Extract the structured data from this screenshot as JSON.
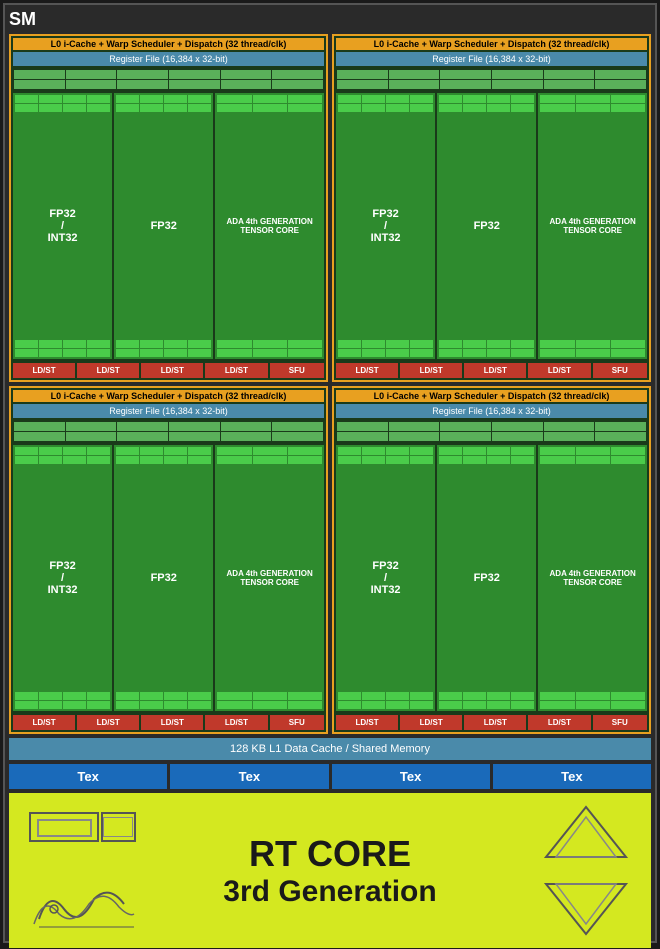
{
  "sm": {
    "title": "SM",
    "quadrants": [
      {
        "l0_cache": "L0 i-Cache + Warp Scheduler + Dispatch (32 thread/clk)",
        "register_file": "Register File (16,384 x 32-bit)",
        "fp32_int32_label": "FP32 / INT32",
        "fp32_label": "FP32",
        "tensor_label": "ADA 4th GENERATION TENSOR CORE",
        "ldst_labels": [
          "LD/ST",
          "LD/ST",
          "LD/ST",
          "LD/ST"
        ],
        "sfu_label": "SFU"
      },
      {
        "l0_cache": "L0 i-Cache + Warp Scheduler + Dispatch (32 thread/clk)",
        "register_file": "Register File (16,384 x 32-bit)",
        "fp32_int32_label": "FP32 / INT32",
        "fp32_label": "FP32",
        "tensor_label": "ADA 4th GENERATION TENSOR CORE",
        "ldst_labels": [
          "LD/ST",
          "LD/ST",
          "LD/ST",
          "LD/ST"
        ],
        "sfu_label": "SFU"
      },
      {
        "l0_cache": "L0 i-Cache + Warp Scheduler + Dispatch (32 thread/clk)",
        "register_file": "Register File (16,384 x 32-bit)",
        "fp32_int32_label": "FP32 / INT32",
        "fp32_label": "FP32",
        "tensor_label": "ADA 4th GENERATION TENSOR CORE",
        "ldst_labels": [
          "LD/ST",
          "LD/ST",
          "LD/ST",
          "LD/ST"
        ],
        "sfu_label": "SFU"
      },
      {
        "l0_cache": "L0 i-Cache + Warp Scheduler + Dispatch (32 thread/clk)",
        "register_file": "Register File (16,384 x 32-bit)",
        "fp32_int32_label": "FP32 / INT32",
        "fp32_label": "FP32",
        "tensor_label": "ADA 4th GENERATION TENSOR CORE",
        "ldst_labels": [
          "LD/ST",
          "LD/ST",
          "LD/ST",
          "LD/ST"
        ],
        "sfu_label": "SFU"
      }
    ],
    "l1_cache": "128 KB L1 Data Cache / Shared Memory",
    "tex_labels": [
      "Tex",
      "Tex",
      "Tex",
      "Tex"
    ],
    "rt_core": {
      "title": "RT CORE",
      "subtitle": "3rd Generation"
    }
  }
}
